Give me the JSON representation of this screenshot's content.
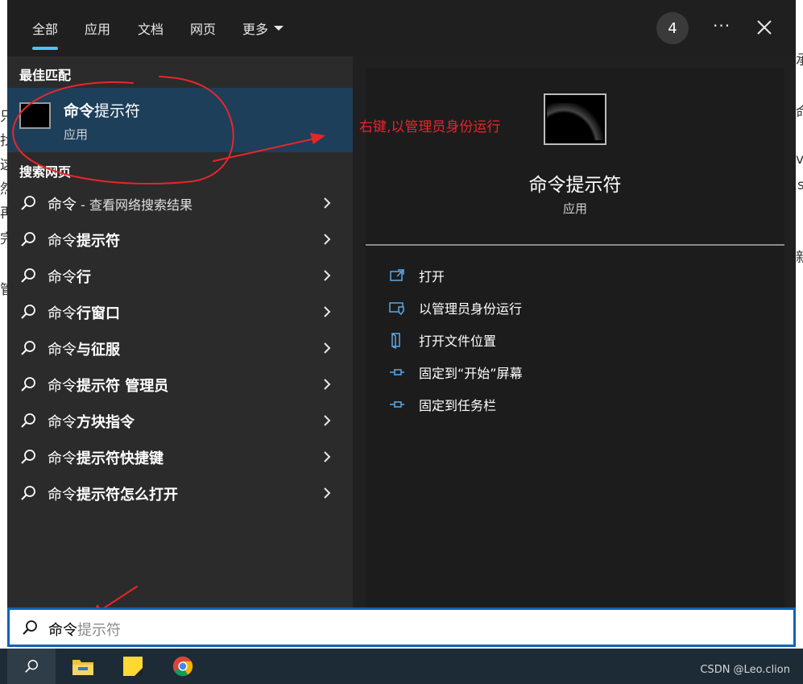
{
  "tabs": [
    {
      "label": "全部"
    },
    {
      "label": "应用"
    },
    {
      "label": "文档"
    },
    {
      "label": "网页"
    },
    {
      "label": "更多"
    }
  ],
  "badge_count": "4",
  "best_match": {
    "section_label": "最佳匹配",
    "title_bold": "命令",
    "title_rest": "提示符",
    "subtitle": "应用"
  },
  "web": {
    "section_label": "搜索网页",
    "items": [
      {
        "query": "命令",
        "bold": "",
        "web_suffix": " - 查看网络搜索结果"
      },
      {
        "query": "命令",
        "bold": "提示符",
        "web_suffix": ""
      },
      {
        "query": "命令",
        "bold": "行",
        "web_suffix": ""
      },
      {
        "query": "命令",
        "bold": "行窗口",
        "web_suffix": ""
      },
      {
        "query": "命令",
        "bold": "与征服",
        "web_suffix": ""
      },
      {
        "query": "命令",
        "bold": "提示符 管理员",
        "web_suffix": ""
      },
      {
        "query": "命令",
        "bold": "方块指令",
        "web_suffix": ""
      },
      {
        "query": "命令",
        "bold": "提示符快捷键",
        "web_suffix": ""
      },
      {
        "query": "命令",
        "bold": "提示符怎么打开",
        "web_suffix": ""
      }
    ]
  },
  "detail": {
    "title": "命令提示符",
    "subtitle": "应用",
    "actions": [
      {
        "label": "打开",
        "icon": "open-icon"
      },
      {
        "label": "以管理员身份运行",
        "icon": "shield-icon"
      },
      {
        "label": "打开文件位置",
        "icon": "file-location-icon"
      },
      {
        "label": "固定到“开始”屏幕",
        "icon": "pin-icon"
      },
      {
        "label": "固定到任务栏",
        "icon": "pin-icon"
      }
    ]
  },
  "annotation": {
    "text": "右键,以管理员身份运行",
    "color": "#e8262a"
  },
  "search": {
    "typed": "命令",
    "suggestion": "提示符"
  },
  "taskbar": {
    "watermark": "CSDN @Leo.clion"
  },
  "colors": {
    "accent": "#4cc2ff",
    "selected_bg": "#1e3f5a",
    "search_border": "#0a63b8"
  }
}
